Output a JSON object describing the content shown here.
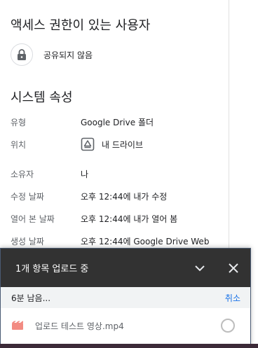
{
  "access": {
    "title": "액세스 권한이 있는 사용자",
    "status": "공유되지 않음",
    "icon": "lock-icon"
  },
  "properties": {
    "title": "시스템 속성",
    "rows": [
      {
        "label": "유형",
        "value": "Google Drive 폴더"
      },
      {
        "label": "위치",
        "value": "내 드라이브"
      },
      {
        "label": "소유자",
        "value": "나"
      },
      {
        "label": "수정 날짜",
        "value": "오후 12:44에 내가 수정"
      },
      {
        "label": "열어 본 날짜",
        "value": "오후 12:44에 내가 열어 봄"
      },
      {
        "label": "생성 날짜",
        "value": "오후 12:44에 Google Drive Web"
      }
    ]
  },
  "upload": {
    "title": "1개 항목 업로드 중",
    "remaining": "6분 남음...",
    "cancel_label": "취소",
    "file_name": "업로드 테스트 영상.mp4",
    "colors": {
      "header": "#323232",
      "accent": "#1a73e8",
      "file_icon": "#f28b82"
    }
  }
}
